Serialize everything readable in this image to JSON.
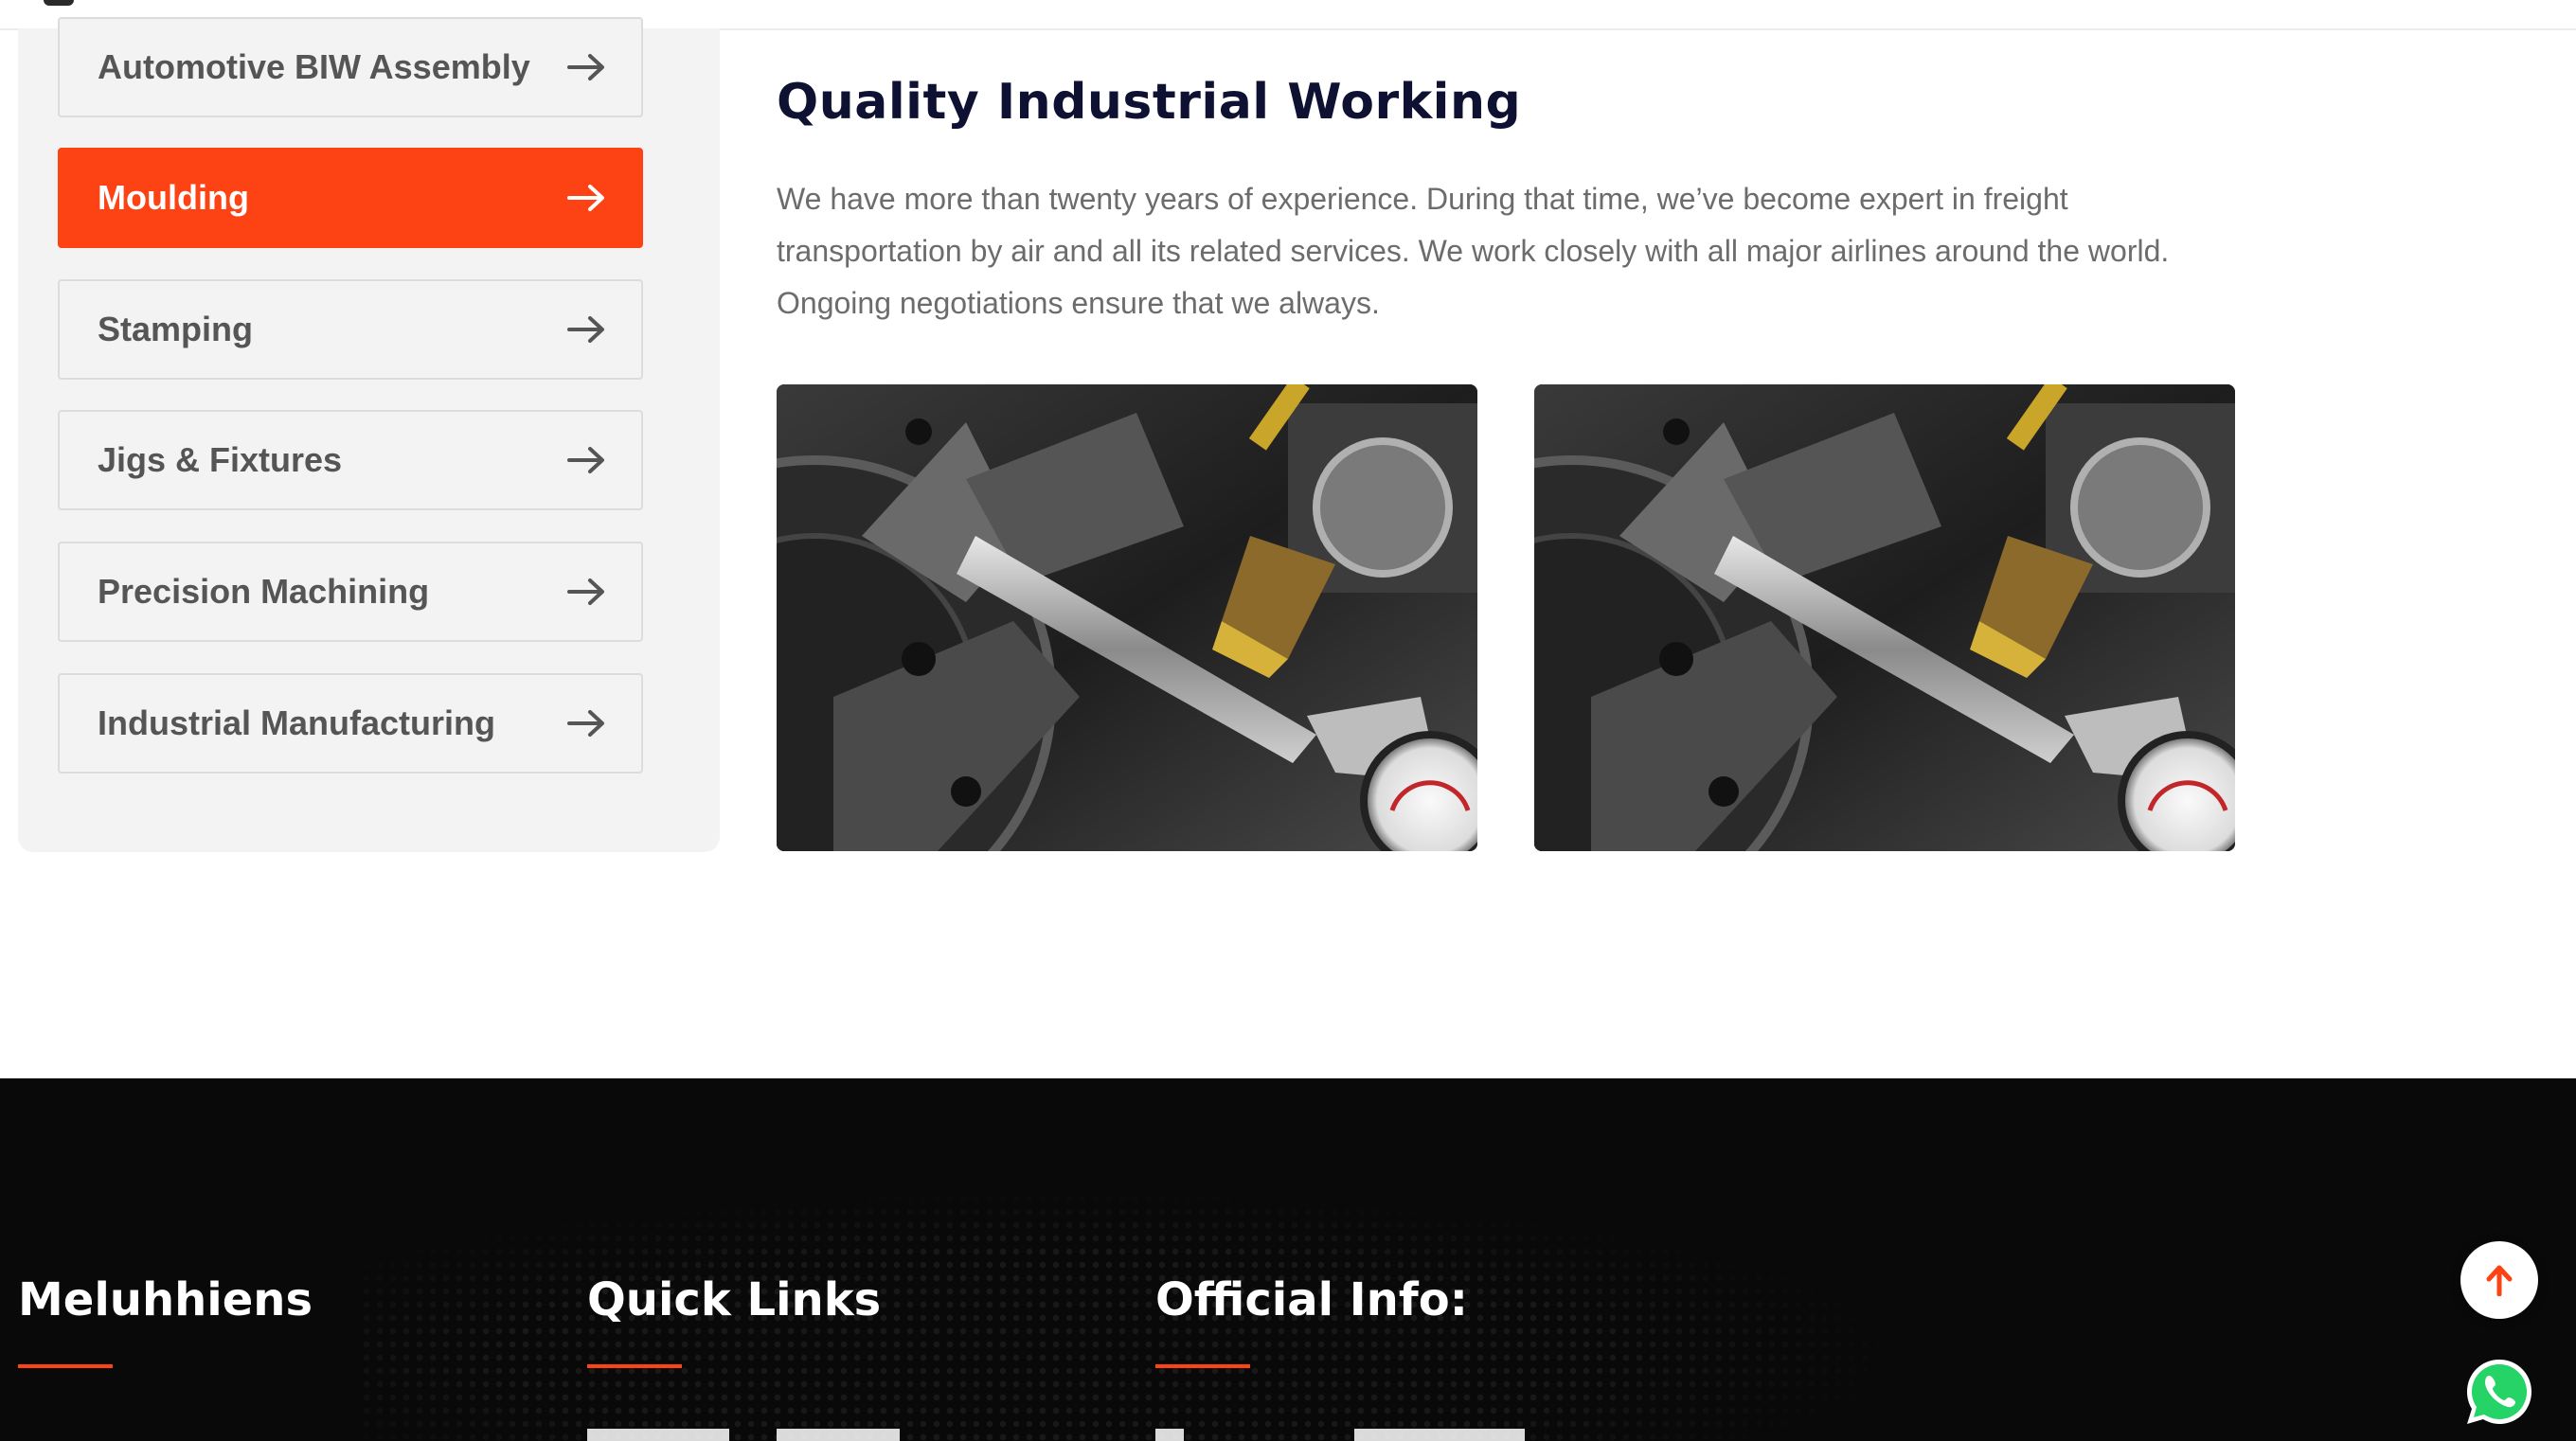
{
  "sidebar": {
    "items": [
      {
        "label": "Automotive BIW Assembly",
        "active": false
      },
      {
        "label": "Moulding",
        "active": true
      },
      {
        "label": "Stamping",
        "active": false
      },
      {
        "label": "Jigs & Fixtures",
        "active": false
      },
      {
        "label": "Precision Machining",
        "active": false
      },
      {
        "label": "Industrial Manufacturing",
        "active": false
      }
    ],
    "arrow_icon": "arrow-right-icon"
  },
  "main": {
    "title": "Quality Industrial Working",
    "description": "We have more than twenty years of experience. During that time, we’ve become expert in freight transportation by air and all its related services. We work closely with all major airlines around the world. Ongoing negotiations ensure that we always.",
    "images": [
      {
        "subject": "cnc-lathe-machining-photo"
      },
      {
        "subject": "cnc-lathe-machining-photo"
      }
    ]
  },
  "footer": {
    "columns": [
      {
        "heading": "Meluhhiens"
      },
      {
        "heading": "Quick Links"
      },
      {
        "heading": "Official Info:"
      }
    ]
  },
  "floating": {
    "back_to_top_icon": "arrow-up-icon",
    "whatsapp_icon": "whatsapp-icon"
  },
  "colors": {
    "accent": "#fd4214",
    "title": "#0f1133",
    "footer_bg": "#080908",
    "sidebar_bg": "#f3f3f3",
    "whatsapp": "#25d366"
  }
}
